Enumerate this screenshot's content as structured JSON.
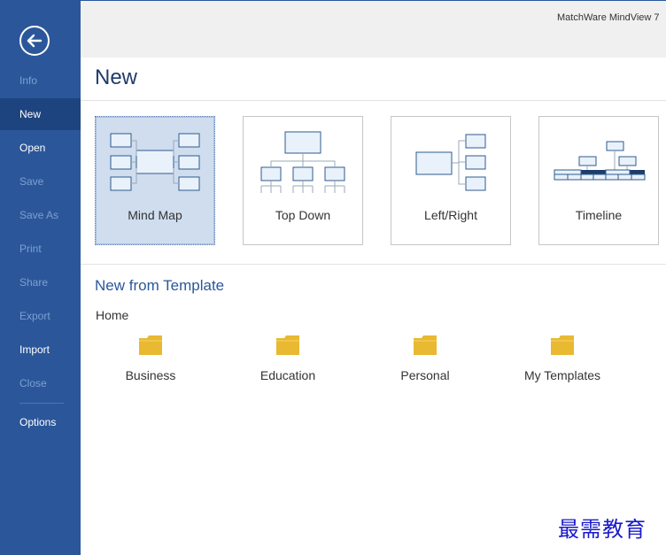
{
  "app": {
    "title": "MatchWare MindView 7"
  },
  "sidebar": {
    "back_icon": "arrow-left-circle-icon",
    "items": [
      {
        "label": "Info",
        "state": "disabled"
      },
      {
        "label": "New",
        "state": "active"
      },
      {
        "label": "Open",
        "state": "enabled"
      },
      {
        "label": "Save",
        "state": "disabled"
      },
      {
        "label": "Save As",
        "state": "disabled"
      },
      {
        "label": "Print",
        "state": "disabled"
      },
      {
        "label": "Share",
        "state": "disabled"
      },
      {
        "label": "Export",
        "state": "disabled"
      },
      {
        "label": "Import",
        "state": "enabled"
      },
      {
        "label": "Close",
        "state": "disabled"
      },
      {
        "label": "Options",
        "state": "enabled"
      }
    ]
  },
  "main": {
    "title": "New",
    "templates": [
      {
        "label": "Mind Map",
        "selected": true
      },
      {
        "label": "Top Down",
        "selected": false
      },
      {
        "label": "Left/Right",
        "selected": false
      },
      {
        "label": "Timeline",
        "selected": false
      }
    ],
    "from_template": {
      "title": "New from Template",
      "breadcrumb": "Home",
      "folders": [
        {
          "label": "Business"
        },
        {
          "label": "Education"
        },
        {
          "label": "Personal"
        },
        {
          "label": "My Templates"
        }
      ]
    }
  },
  "colors": {
    "sidebar": "#2b579a",
    "sidebar_active": "#1e4480",
    "accent": "#2b579a",
    "folder": "#e8b931",
    "diagram_stroke": "#2f5b8e"
  },
  "watermark": "最需教育"
}
